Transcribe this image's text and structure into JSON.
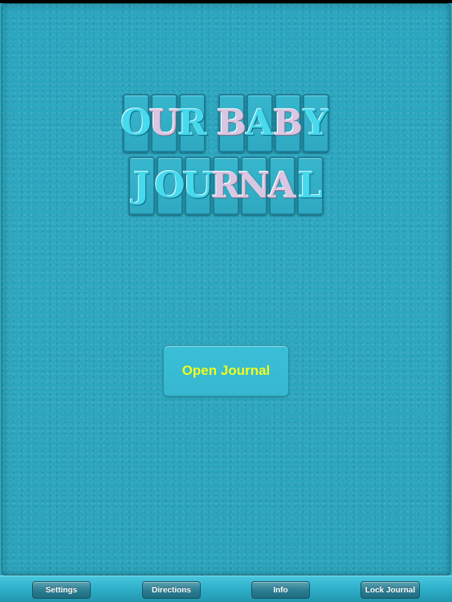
{
  "cover": {
    "title_line1": [
      "O",
      "U",
      "R",
      " ",
      "B",
      "A",
      "B",
      "Y"
    ],
    "title_line2": [
      "J",
      "O",
      "U",
      "R",
      "N",
      "A",
      "L"
    ],
    "pink_letters_line1": [
      1,
      4,
      6
    ],
    "pink_letters_line2": [
      3,
      4,
      5
    ],
    "open_button_label": "Open Journal",
    "colors": {
      "background": "#2aa3bb",
      "letter_blue": "#47d9ee",
      "letter_pink": "#d8c6e2",
      "button_text": "#f2ff1a"
    }
  },
  "toolbar": {
    "buttons": [
      {
        "label": "Settings"
      },
      {
        "label": "Directions"
      },
      {
        "label": "Info"
      },
      {
        "label": "Lock Journal"
      }
    ]
  }
}
